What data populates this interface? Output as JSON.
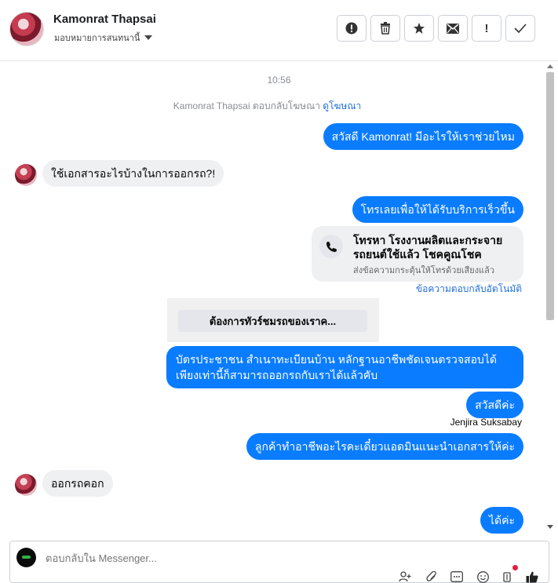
{
  "header": {
    "contact_name": "Kamonrat Thapsai",
    "assign_label": "มอบหมายการสนทนานี้",
    "tools": [
      {
        "name": "spam-report",
        "glyph": "!",
        "icon": "exclamation-circle-icon"
      },
      {
        "name": "delete",
        "glyph": "🗑",
        "icon": "trash-icon"
      },
      {
        "name": "star",
        "glyph": "★",
        "icon": "star-icon"
      },
      {
        "name": "mark-unread",
        "glyph": "✉",
        "icon": "envelope-icon"
      },
      {
        "name": "follow-up",
        "glyph": "!",
        "icon": "exclamation-icon"
      },
      {
        "name": "mark-done",
        "glyph": "✓",
        "icon": "checkmark-icon"
      }
    ]
  },
  "conversation": {
    "time": "10:56",
    "ad_reply_text": "Kamonrat Thapsai ตอบกลับโฆษณา",
    "ad_link": "ดูโฆษณา",
    "messages": {
      "m1": "สวัสดี Kamonrat! มีอะไรให้เราช่วยไหม",
      "m2": "ใช้เอกสารอะไรบ้างในการออกรถ?!",
      "m3": "โทรเลยเพื่อให้ได้รับบริการเร็วขึ้น",
      "m4": "บัตรประชาชน สำเนาทะเบียนบ้าน หลักฐานอาชีพชัดเจนตรวจสอบได้ เพียงเท่านี้ก็สามารถออกรถกับเราได้แล้วคับ",
      "m5": "สวัสดีค่ะ",
      "m6": "ลูกค้าทำอาชีพอะไรคะเดี๋ยวแอดมินแนะนำเอกสารให้ค่ะ",
      "m7": "ออกรถคอก",
      "m8": "ได้ค่ะ"
    },
    "call_card": {
      "title": "โทรหา โรงงานผลิตและกระจายรถยนต์ใช้แล้ว โชคคูณโชค",
      "subtitle": "ส่งข้อความกระตุ้นให้โทรด้วยเสียงแล้ว"
    },
    "auto_reply_label": "ข้อความตอบกลับอัตโนมัติ",
    "template_button": "ต้องการทัวร์ชมรถของเราค...",
    "sender_name": "Jenjira Suksabay"
  },
  "composer": {
    "placeholder": "ตอบกลับใน Messenger..."
  },
  "colors": {
    "outgoing_bubble": "#0a7cff",
    "incoming_bubble": "#eff0f2",
    "link": "#216fdb"
  }
}
